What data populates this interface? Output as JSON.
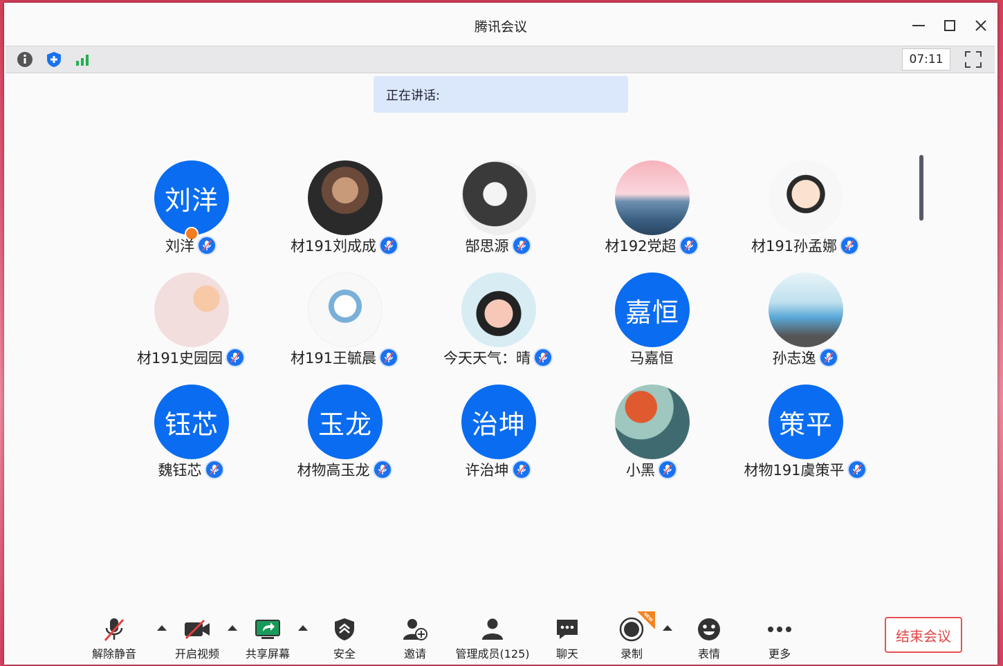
{
  "window": {
    "title": "腾讯会议"
  },
  "infobar": {
    "timer": "07:11"
  },
  "speaking": {
    "label": "正在讲话:"
  },
  "members": [
    {
      "name": "刘洋",
      "avatar_text": "刘洋",
      "host": true
    },
    {
      "name": "材191刘成成",
      "avatar_text": ""
    },
    {
      "name": "郜思源",
      "avatar_text": ""
    },
    {
      "name": "材192党超",
      "avatar_text": ""
    },
    {
      "name": "材191孙孟娜",
      "avatar_text": ""
    },
    {
      "name": "材191史园园",
      "avatar_text": ""
    },
    {
      "name": "材191王毓晨",
      "avatar_text": ""
    },
    {
      "name": "今天天气：晴",
      "avatar_text": ""
    },
    {
      "name": "马嘉恒",
      "avatar_text": "嘉恒"
    },
    {
      "name": "孙志逸",
      "avatar_text": ""
    },
    {
      "name": "魏钰芯",
      "avatar_text": "钰芯"
    },
    {
      "name": "材物高玉龙",
      "avatar_text": "玉龙"
    },
    {
      "name": "许治坤",
      "avatar_text": "治坤"
    },
    {
      "name": "小黑",
      "avatar_text": ""
    },
    {
      "name": "材物191虞策平",
      "avatar_text": "策平"
    }
  ],
  "toolbar": {
    "unmute": "解除静音",
    "video": "开启视频",
    "share": "共享屏幕",
    "security": "安全",
    "invite": "邀请",
    "members": "管理成员(125)",
    "chat": "聊天",
    "record": "录制",
    "record_badge": "NEW",
    "reactions": "表情",
    "more": "更多",
    "end": "结束会议"
  },
  "colors": {
    "accent": "#0a6cf0",
    "end": "#e04545",
    "speaking_bg": "#dbe8fb"
  }
}
